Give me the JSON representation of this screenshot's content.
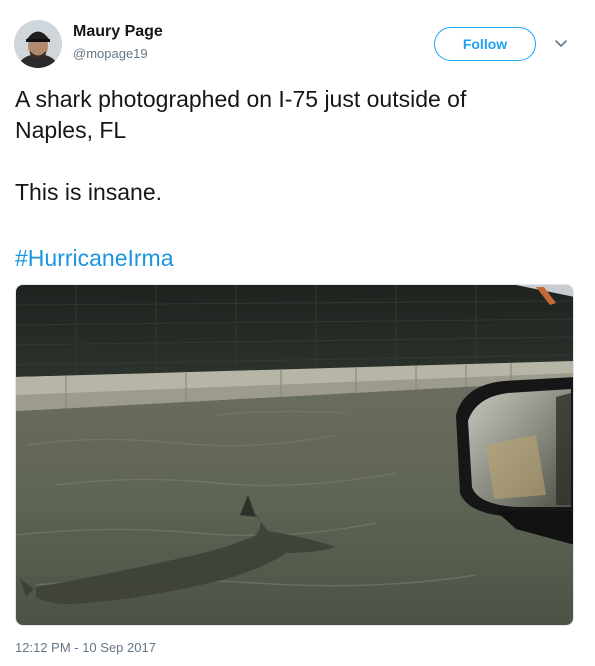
{
  "tweet": {
    "author": {
      "display_name": "Maury Page",
      "handle": "@mopage19",
      "avatar_icon": "user-avatar"
    },
    "follow_label": "Follow",
    "menu_icon": "chevron-down-icon",
    "text_lines": [
      "A shark photographed on I-75 just outside of",
      "Naples, FL",
      "This is insane."
    ],
    "hashtag": "#HurricaneIrma",
    "media": {
      "description_icon": "flooded-highway-photo"
    },
    "timestamp": "12:12 PM - 10 Sep 2017"
  },
  "colors": {
    "accent": "#1da1f2",
    "link": "#1b95e0",
    "secondary_text": "#657786",
    "primary_text": "#14171a"
  }
}
